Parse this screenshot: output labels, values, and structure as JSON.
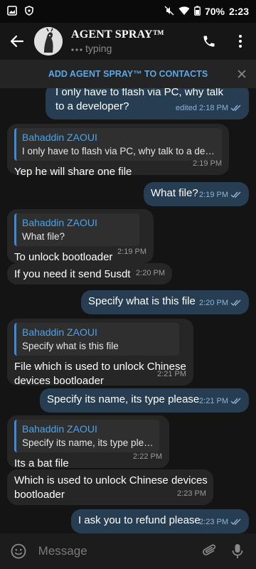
{
  "status_bar": {
    "battery": "70%",
    "time": "2:23"
  },
  "header": {
    "title": "AGENT SPRAY™",
    "status": "typing"
  },
  "banner": {
    "text": "ADD AGENT SPRAY™ TO CONTACTS"
  },
  "messages": [
    {
      "dir": "out",
      "text": "I only have to flash via PC, why talk to a developer?",
      "time": "edited 2:18 PM"
    },
    {
      "dir": "in",
      "reply_name": "Bahaddin ZAOUI",
      "reply_text": "I only have to flash via PC, why talk to a devel...",
      "text": "Yep he will share one file",
      "time": "2:19 PM"
    },
    {
      "dir": "out",
      "text": "What file?",
      "time": "2:19 PM"
    },
    {
      "dir": "in",
      "reply_name": "Bahaddin ZAOUI",
      "reply_text": "What file?",
      "text": "To unlock bootloader",
      "time": "2:19 PM"
    },
    {
      "dir": "in",
      "text": "If you need it send 5usdt",
      "time": "2:20 PM"
    },
    {
      "dir": "out",
      "text": "Specify what is this file",
      "time": "2:20 PM"
    },
    {
      "dir": "in",
      "reply_name": "Bahaddin ZAOUI",
      "reply_text": "Specify what is this file",
      "text": "File which is used to unlock Chinese devices bootloader",
      "time": "2:21 PM"
    },
    {
      "dir": "out",
      "text": "Specify its name, its type please",
      "time": "2:21 PM"
    },
    {
      "dir": "in",
      "reply_name": "Bahaddin ZAOUI",
      "reply_text": "Specify its name, its type please",
      "text": "Its a bat file",
      "time": "2:22 PM"
    },
    {
      "dir": "in",
      "text": "Which is used to unlock Chinese devices bootloader",
      "time": "2:23 PM"
    },
    {
      "dir": "out",
      "text": "I ask you to refund please",
      "time": "2:23 PM"
    }
  ],
  "input": {
    "placeholder": "Message"
  },
  "icons": {
    "back": "arrow-left-icon",
    "call": "phone-icon",
    "menu": "more-vertical-icon",
    "close": "close-icon",
    "emoji": "emoji-icon",
    "attach": "paperclip-icon",
    "mic": "microphone-icon",
    "read": "double-check-icon"
  },
  "colors": {
    "accent": "#5aa8e8",
    "outgoing_bubble": "#273d52",
    "incoming_bubble": "#262626"
  }
}
